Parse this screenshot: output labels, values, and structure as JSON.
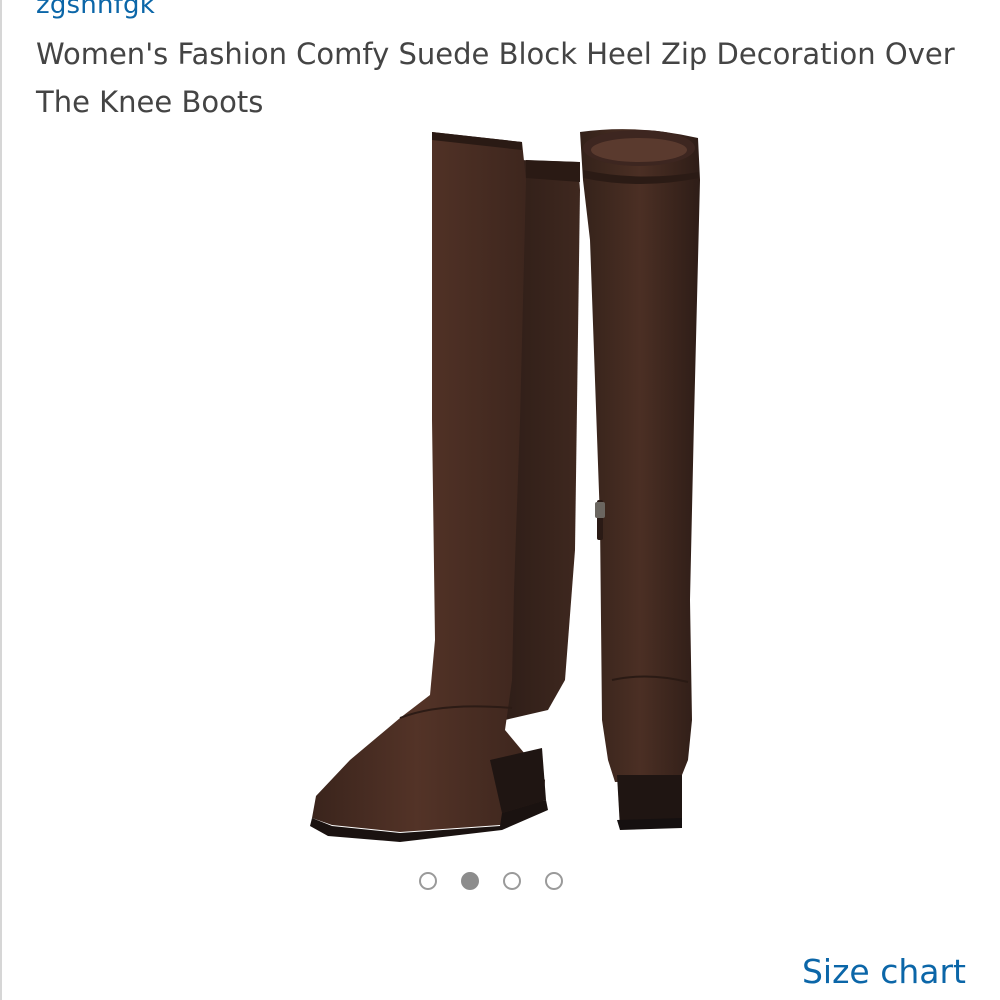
{
  "product": {
    "brand": "zgshnfgk",
    "title": "Women's Fashion Comfy Suede Block Heel Zip Decoration Over The Knee Boots"
  },
  "gallery": {
    "image_description_icon": "boot-pair-image",
    "dot_count": 4,
    "active_index": 1
  },
  "links": {
    "size_chart": "Size chart"
  },
  "colors": {
    "link": "#0b66a8",
    "title_text": "#444444",
    "boot_primary": "#4a2d22",
    "boot_shadow": "#2c1b15",
    "dot_active": "#8c8c8c"
  }
}
